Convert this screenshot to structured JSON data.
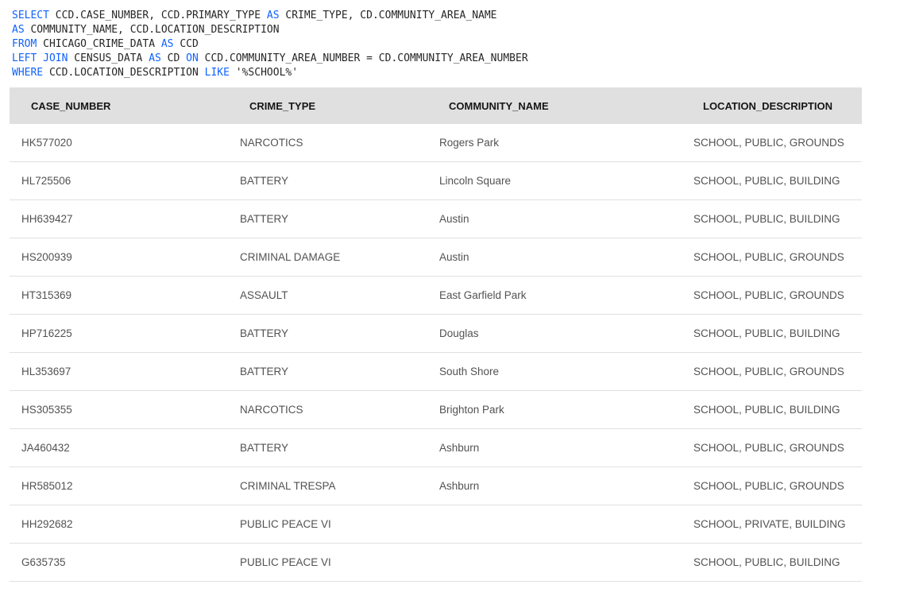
{
  "query": {
    "line1": {
      "k1": "SELECT",
      "t1": " CCD.CASE_NUMBER, CCD.PRIMARY_TYPE ",
      "k2": "AS",
      "t2": " CRIME_TYPE, CD.COMMUNITY_AREA_NAME"
    },
    "line2": {
      "k1": "AS",
      "t1": " COMMUNITY_NAME, CCD.LOCATION_DESCRIPTION"
    },
    "line3": {
      "k1": "FROM",
      "t1": " CHICAGO_CRIME_DATA ",
      "k2": "AS",
      "t2": " CCD"
    },
    "line4": {
      "k1": "LEFT JOIN",
      "t1": " CENSUS_DATA ",
      "k2": "AS",
      "t2": " CD ",
      "k3": "ON",
      "t3": " CCD.COMMUNITY_AREA_NUMBER = CD.COMMUNITY_AREA_NUMBER"
    },
    "line5": {
      "k1": "WHERE",
      "t1": " CCD.LOCATION_DESCRIPTION ",
      "k2": "LIKE",
      "t2": " '%SCHOOL%'"
    }
  },
  "table": {
    "headers": [
      "CASE_NUMBER",
      "CRIME_TYPE",
      "COMMUNITY_NAME",
      "LOCATION_DESCRIPTION"
    ],
    "rows": [
      [
        "HK577020",
        "NARCOTICS",
        "Rogers Park",
        "SCHOOL, PUBLIC, GROUNDS"
      ],
      [
        "HL725506",
        "BATTERY",
        "Lincoln Square",
        "SCHOOL, PUBLIC, BUILDING"
      ],
      [
        "HH639427",
        "BATTERY",
        "Austin",
        "SCHOOL, PUBLIC, BUILDING"
      ],
      [
        "HS200939",
        "CRIMINAL DAMAGE",
        "Austin",
        "SCHOOL, PUBLIC, GROUNDS"
      ],
      [
        "HT315369",
        "ASSAULT",
        "East Garfield Park",
        "SCHOOL, PUBLIC, GROUNDS"
      ],
      [
        "HP716225",
        "BATTERY",
        "Douglas",
        "SCHOOL, PUBLIC, BUILDING"
      ],
      [
        "HL353697",
        "BATTERY",
        "South Shore",
        "SCHOOL, PUBLIC, GROUNDS"
      ],
      [
        "HS305355",
        "NARCOTICS",
        "Brighton Park",
        "SCHOOL, PUBLIC, BUILDING"
      ],
      [
        "JA460432",
        "BATTERY",
        "Ashburn",
        "SCHOOL, PUBLIC, GROUNDS"
      ],
      [
        "HR585012",
        "CRIMINAL TRESPA",
        "Ashburn",
        "SCHOOL, PUBLIC, GROUNDS"
      ],
      [
        "HH292682",
        "PUBLIC PEACE VI",
        "",
        "SCHOOL, PRIVATE, BUILDING"
      ],
      [
        "G635735",
        "PUBLIC PEACE VI",
        "",
        "SCHOOL, PUBLIC, BUILDING"
      ]
    ]
  }
}
